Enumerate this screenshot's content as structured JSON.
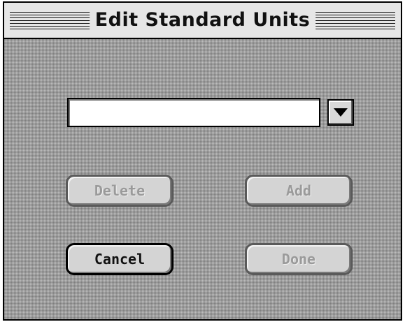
{
  "window": {
    "title": "Edit Standard Units"
  },
  "unit_selector": {
    "value": "",
    "dropdown_icon": "triangle-down-icon"
  },
  "buttons": {
    "delete": {
      "label": "Delete",
      "enabled": false
    },
    "add": {
      "label": "Add",
      "enabled": false
    },
    "cancel": {
      "label": "Cancel",
      "enabled": true
    },
    "done": {
      "label": "Done",
      "enabled": false
    }
  }
}
